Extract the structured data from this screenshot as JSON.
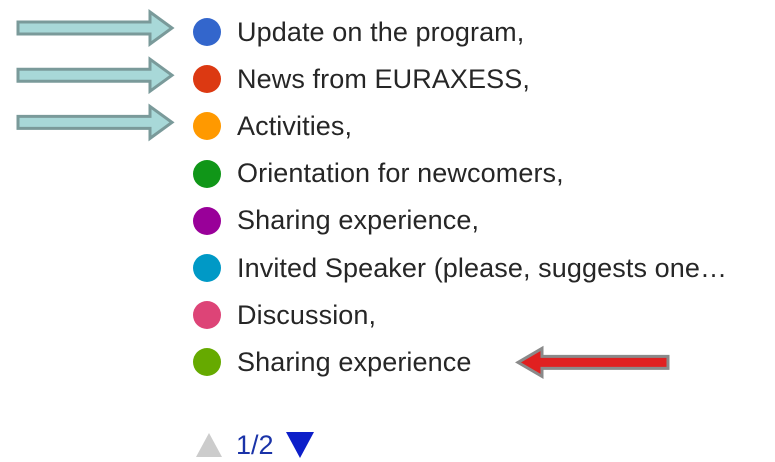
{
  "chart_data": {
    "type": "pie",
    "legend": [
      {
        "label": "Update on the program,",
        "color": "#3366cc"
      },
      {
        "label": "News from EURAXESS,",
        "color": "#dc3912"
      },
      {
        "label": "Activities,",
        "color": "#ff9900"
      },
      {
        "label": "Orientation for newcomers,",
        "color": "#109618"
      },
      {
        "label": "Sharing experience,",
        "color": "#990099"
      },
      {
        "label": "Invited Speaker (please, suggests one…",
        "color": "#0099c6"
      },
      {
        "label": "Discussion,",
        "color": "#dd4477"
      },
      {
        "label": "Sharing experience",
        "color": "#66aa00"
      }
    ],
    "pagination": {
      "label": "1/2",
      "prev_color": "#cccccc",
      "next_color": "#0d1fc9"
    }
  },
  "annotations": {
    "highlight_arrow_color": "#a8d8d8",
    "highlight_arrow_outline": "#7a9a9a",
    "accent_arrow_color": "#e02020",
    "accent_arrow_outline": "#8a8a8a",
    "highlighted_items": [
      0,
      1,
      2
    ],
    "accent_item": 7
  },
  "icons": {
    "prev": "triangle-up-icon",
    "next": "triangle-down-icon",
    "highlight": "arrow-right-icon",
    "accent": "arrow-left-icon"
  }
}
